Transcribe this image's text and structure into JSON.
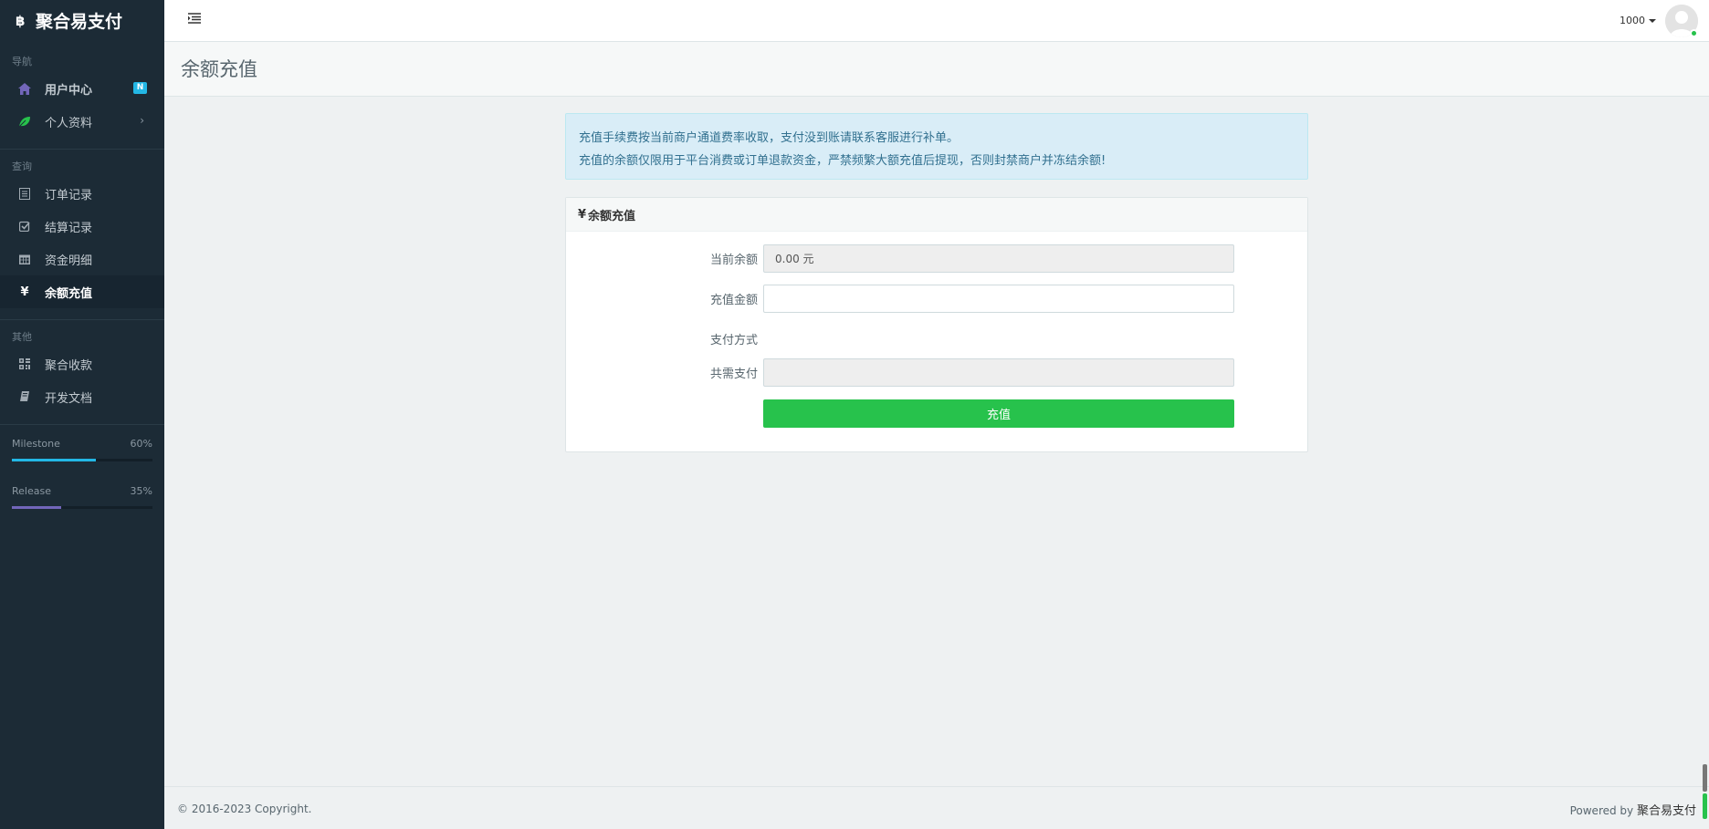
{
  "brand": {
    "name": "聚合易支付"
  },
  "sidebar": {
    "sections": [
      {
        "heading": "导航"
      },
      {
        "heading": "查询"
      },
      {
        "heading": "其他"
      }
    ],
    "nav": {
      "user_center": {
        "label": "用户中心",
        "badge": "N"
      },
      "profile": {
        "label": "个人资料",
        "chevron": "›"
      },
      "orders": {
        "label": "订单记录"
      },
      "settlement": {
        "label": "结算记录"
      },
      "funds": {
        "label": "资金明细"
      },
      "recharge": {
        "label": "余额充值"
      },
      "aggregate": {
        "label": "聚合收款"
      },
      "docs": {
        "label": "开发文档"
      }
    },
    "progress": [
      {
        "label": "Milestone",
        "value_text": "60%",
        "value": 0.6,
        "color": "#23b7e5"
      },
      {
        "label": "Release",
        "value_text": "35%",
        "value": 0.35,
        "color": "#7266ba"
      }
    ]
  },
  "header": {
    "user_label": "1000"
  },
  "page": {
    "title": "余额充值"
  },
  "alert": {
    "line1": "充值手续费按当前商户通道费率收取，支付没到账请联系客服进行补单。",
    "line2": "充值的余额仅限用于平台消费或订单退款资金，严禁频繁大额充值后提现，否则封禁商户并冻结余额!"
  },
  "panel": {
    "heading_symbol": "¥",
    "heading": "余额充值",
    "fields": {
      "current_balance": {
        "label": "当前余额",
        "value": "0.00 元"
      },
      "recharge_amount": {
        "label": "充值金额",
        "value": ""
      },
      "pay_method": {
        "label": "支付方式"
      },
      "total_pay": {
        "label": "共需支付",
        "value": ""
      }
    },
    "submit_label": "充值"
  },
  "footer": {
    "copyright": "© 2016-2023 Copyright.",
    "powered_prefix": "Powered by",
    "powered_brand": "聚合易支付"
  },
  "colors": {
    "sidebar_bg": "#1c2b36",
    "accent_green": "#27c24c",
    "info_blue": "#23b7e5"
  }
}
